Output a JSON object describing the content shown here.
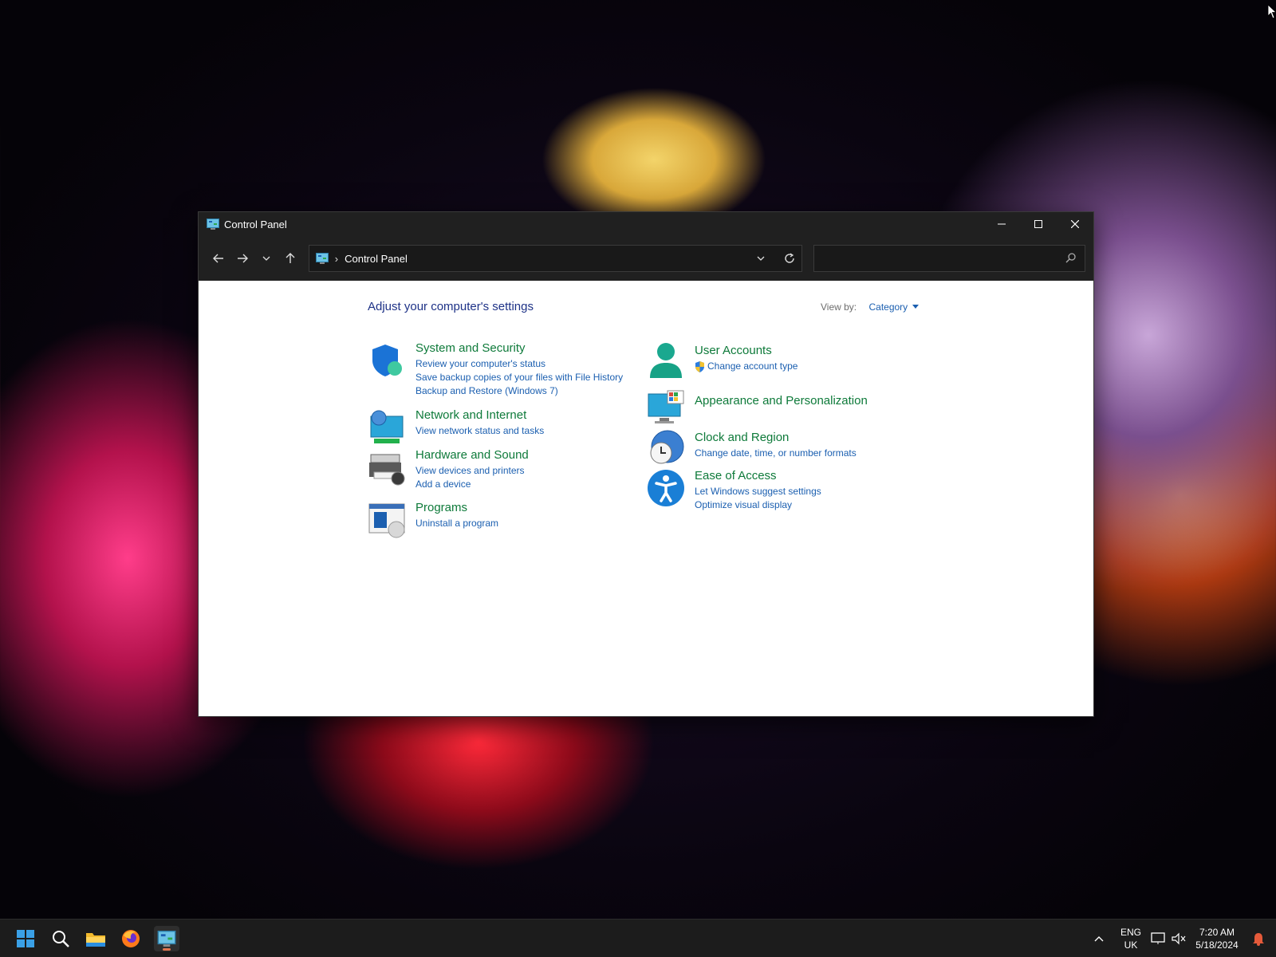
{
  "window": {
    "title": "Control Panel",
    "address_label": "Control Panel",
    "search_placeholder": ""
  },
  "content": {
    "heading": "Adjust your computer's settings",
    "view_by_label": "View by:",
    "view_by_value": "Category"
  },
  "categories": {
    "system_security": {
      "title": "System and Security",
      "links": [
        "Review your computer's status",
        "Save backup copies of your files with File History",
        "Backup and Restore (Windows 7)"
      ]
    },
    "network": {
      "title": "Network and Internet",
      "links": [
        "View network status and tasks"
      ]
    },
    "hardware": {
      "title": "Hardware and Sound",
      "links": [
        "View devices and printers",
        "Add a device"
      ]
    },
    "programs": {
      "title": "Programs",
      "links": [
        "Uninstall a program"
      ]
    },
    "user_accounts": {
      "title": "User Accounts",
      "links": [
        "Change account type"
      ]
    },
    "appearance": {
      "title": "Appearance and Personalization",
      "links": []
    },
    "clock": {
      "title": "Clock and Region",
      "links": [
        "Change date, time, or number formats"
      ]
    },
    "ease": {
      "title": "Ease of Access",
      "links": [
        "Let Windows suggest settings",
        "Optimize visual display"
      ]
    }
  },
  "taskbar": {
    "lang_line1": "ENG",
    "lang_line2": "UK",
    "time": "7:20 AM",
    "date": "5/18/2024",
    "active_app": "Control Panel",
    "icons": [
      "start-icon",
      "search-icon",
      "file-explorer-icon",
      "firefox-icon",
      "control-panel-icon"
    ]
  },
  "colors": {
    "title_green": "#0e7a3a",
    "link_blue": "#1b5fb0",
    "heading_blue": "#1e3287",
    "chrome_dark": "#202020"
  }
}
